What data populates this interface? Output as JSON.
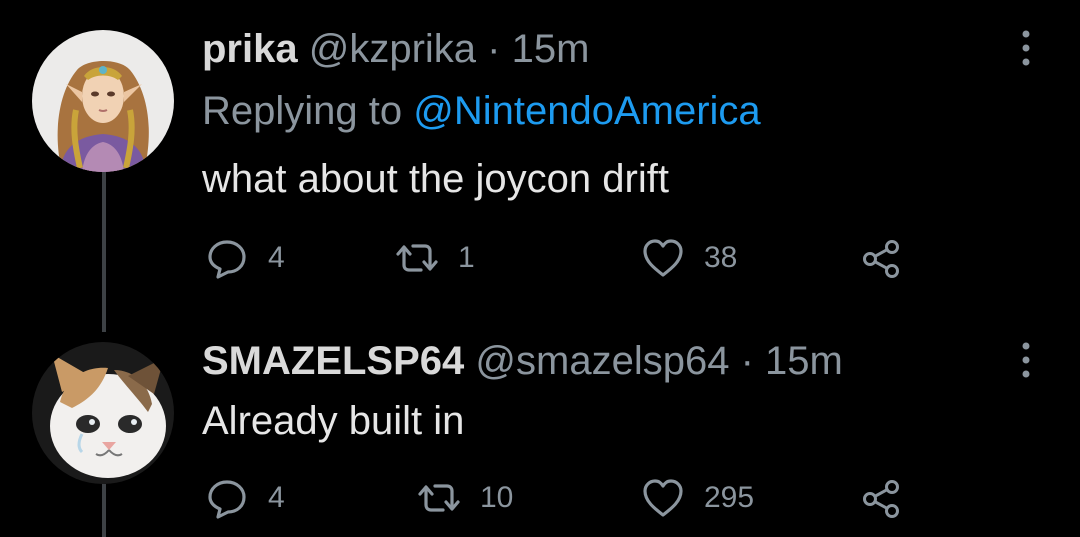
{
  "tweets": [
    {
      "name": "prika",
      "handle": "@kzprika",
      "separator": "·",
      "time": "15m",
      "replying_prefix": "Replying to",
      "replying_to": "@NintendoAmerica",
      "text": "what about the joycon drift",
      "replies": "4",
      "retweets": "1",
      "likes": "38",
      "avatar_icon": "zelda-princess-avatar"
    },
    {
      "name": "SMAZELSP64",
      "handle": "@smazelsp64",
      "separator": "·",
      "time": "15m",
      "text": "Already built in",
      "replies": "4",
      "retweets": "10",
      "likes": "295",
      "avatar_icon": "crying-cat-avatar"
    }
  ],
  "icons": {
    "reply": "speech-bubble-icon",
    "retweet": "retweet-arrows-icon",
    "like": "heart-icon",
    "share": "share-nodes-icon",
    "more": "vertical-dots-icon"
  },
  "colors": {
    "background": "#000000",
    "text": "#e6e6e6",
    "muted": "#8b959e",
    "mention": "#1d9bf0",
    "thread_line": "#3d4145"
  }
}
